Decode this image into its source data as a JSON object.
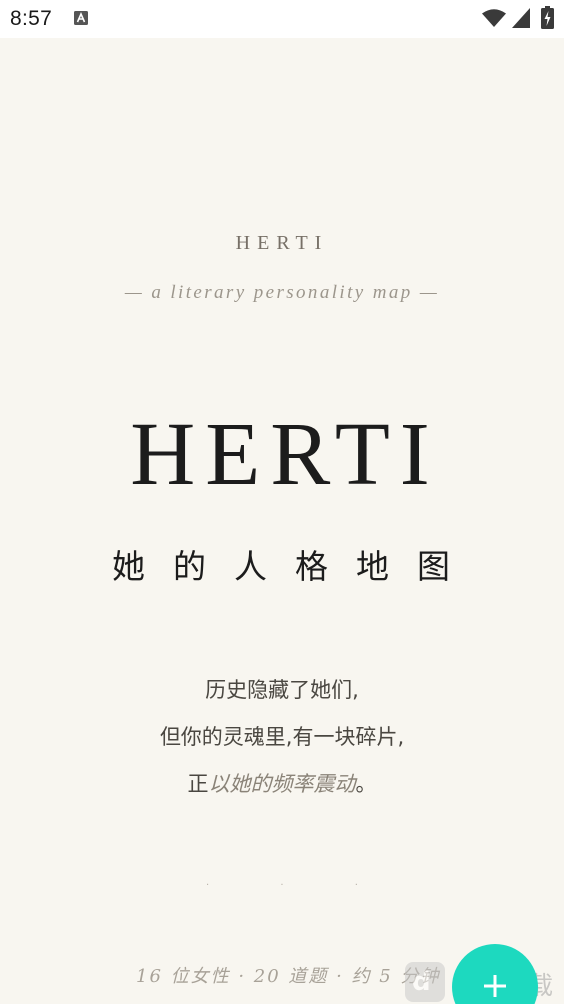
{
  "status_bar": {
    "time": "8:57",
    "icons": [
      "notification-a-icon",
      "wifi-icon",
      "signal-icon",
      "battery-icon"
    ]
  },
  "brand": {
    "small": "HERTI",
    "tagline": "— a literary personality map —",
    "large": "HERTI",
    "subtitle": "她的人格地图"
  },
  "poem": {
    "line1": "历史隐藏了她们,",
    "line2": "但你的灵魂里,有一块碎片,",
    "line3_prefix": "正",
    "line3_accent": "以她的频率震动",
    "line3_suffix": "。"
  },
  "dots": "· · ·",
  "footer": {
    "meta": "16 位女性 · 20 道题 · 约 5 分钟"
  },
  "fab": {
    "icon": "plus-icon",
    "color": "#1dd9bf"
  },
  "watermark": {
    "logo_mark": "d",
    "text": "一本下载"
  },
  "colors": {
    "background": "#f8f6f0",
    "ink": "#1c1c1c",
    "muted": "#9c968c",
    "accent": "#1dd9bf"
  }
}
